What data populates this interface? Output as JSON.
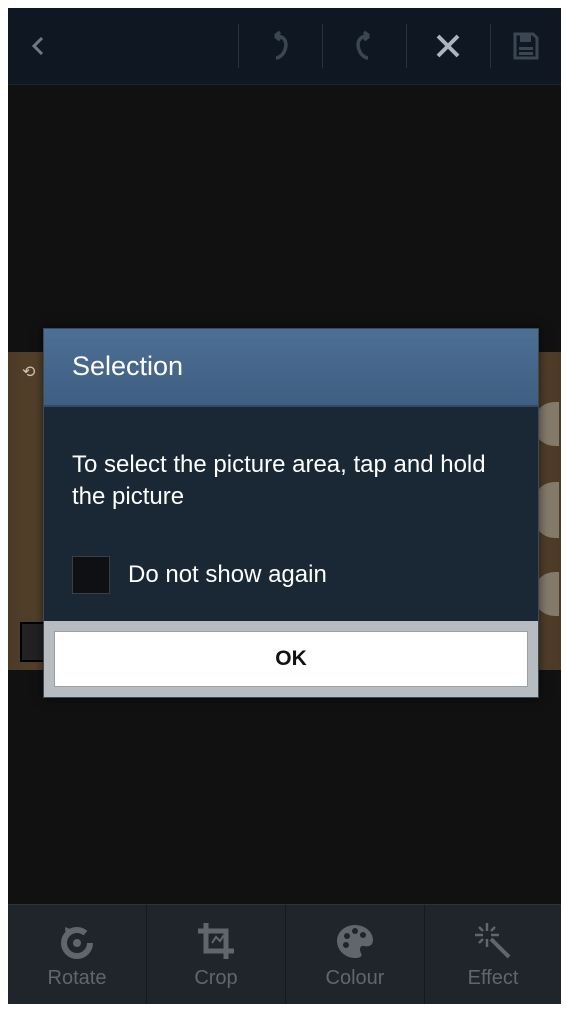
{
  "dialog": {
    "title": "Selection",
    "message": "To select the picture area, tap and hold the picture",
    "checkbox_label": "Do not show again",
    "ok_label": "OK"
  },
  "toolbar": {
    "items": [
      {
        "label": "Rotate",
        "icon": "rotate-icon"
      },
      {
        "label": "Crop",
        "icon": "crop-icon"
      },
      {
        "label": "Colour",
        "icon": "palette-icon"
      },
      {
        "label": "Effect",
        "icon": "magic-wand-icon"
      }
    ]
  },
  "topbar": {
    "icons": [
      "back-icon",
      "undo-icon",
      "redo-icon",
      "close-icon",
      "save-icon"
    ]
  },
  "colors": {
    "dialog_header": "#4d6f93",
    "dialog_body": "#1a2836",
    "toolbar_bg": "#1f252b"
  }
}
